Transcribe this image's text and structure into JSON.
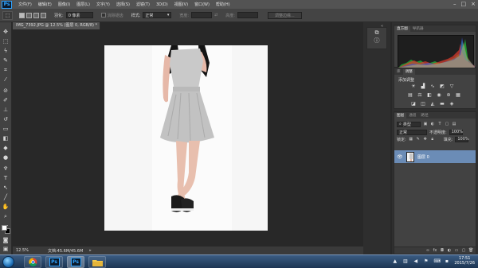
{
  "app": {
    "logo": "Ps"
  },
  "menu": [
    "文件(F)",
    "编辑(E)",
    "图像(I)",
    "图层(L)",
    "文字(Y)",
    "选择(S)",
    "滤镜(T)",
    "3D(D)",
    "视图(V)",
    "窗口(W)",
    "帮助(H)"
  ],
  "window_controls": {
    "minimize": "–",
    "restore": "□",
    "close": "×"
  },
  "options": {
    "feather_label": "羽化:",
    "feather_value": "0 像素",
    "antialias_label": "消除锯齿",
    "style_label": "样式:",
    "style_value": "正常",
    "width_label": "宽度:",
    "height_label": "高度:",
    "refine_edge": "调整边缘..."
  },
  "document": {
    "tab_title": "IMG_7392.JPG @ 12.5% (图层 0, RGB/8) *",
    "zoom": "12.5%",
    "doc_info": "文档:45.6M/45.6M"
  },
  "panels": {
    "histogram_tabs": [
      "直方图",
      "导航器"
    ],
    "adjust_tabs": [
      "库",
      "调整"
    ],
    "adjust_title": "添加调整",
    "layers_tabs": [
      "图层",
      "通道",
      "路径"
    ],
    "filter_kind": "类型",
    "blend_mode": "正常",
    "opacity_label": "不透明度:",
    "opacity_value": "100%",
    "lock_label": "锁定:",
    "fill_label": "填充:",
    "fill_value": "100%",
    "layer_name": "图层 0"
  },
  "taskbar": {
    "clock_time": "17:51",
    "clock_date": "2015/7/26"
  },
  "colors": {
    "ps_blue": "#2fa3ff",
    "layer_selected": "#6b8cb6",
    "taskbar_top": "#3b5c82"
  }
}
